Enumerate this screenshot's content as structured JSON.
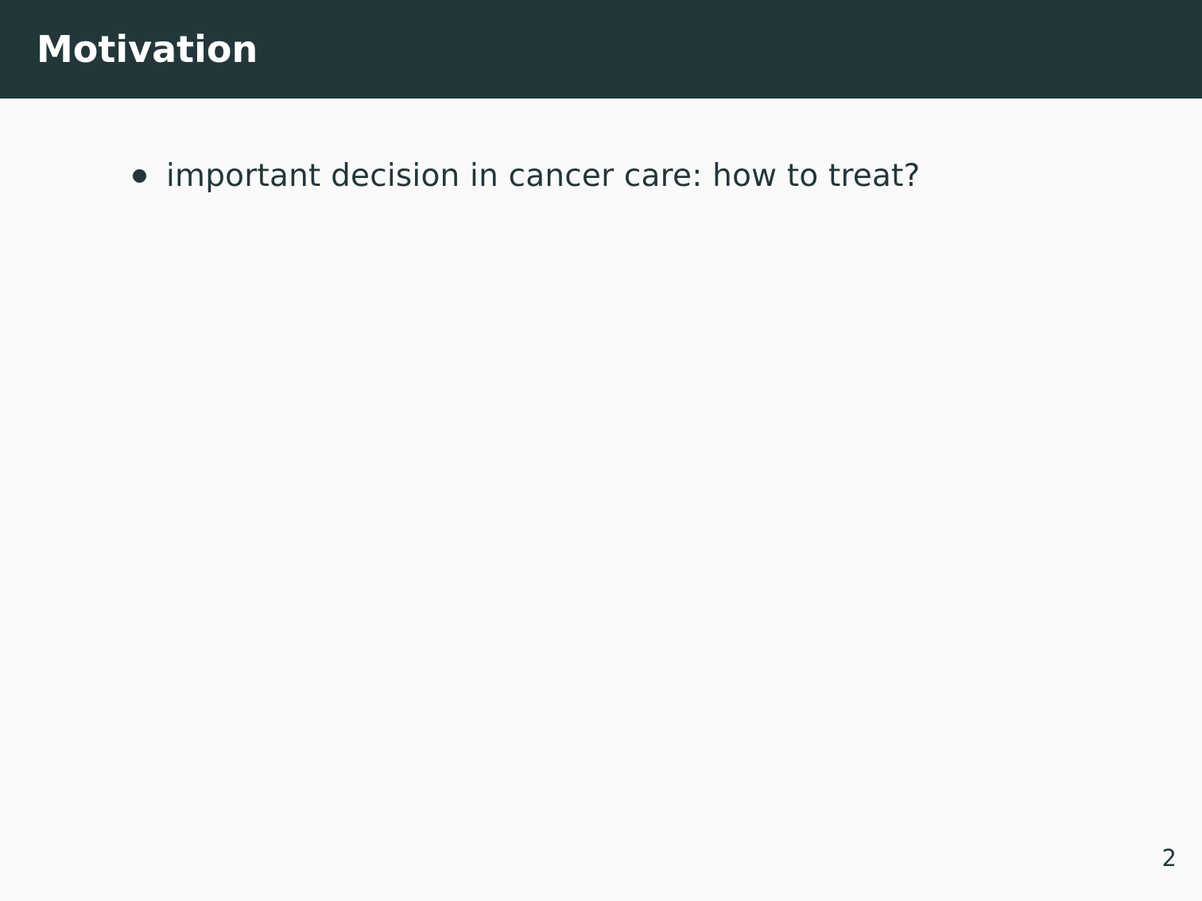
{
  "slide": {
    "title": "Motivation",
    "bullets": [
      {
        "text": "important decision in cancer care: how to treat?"
      }
    ],
    "page_number": "2"
  },
  "colors": {
    "header_background": "#23373b",
    "slide_background": "#fafafa",
    "text": "#23373b",
    "title_text": "#ffffff"
  }
}
